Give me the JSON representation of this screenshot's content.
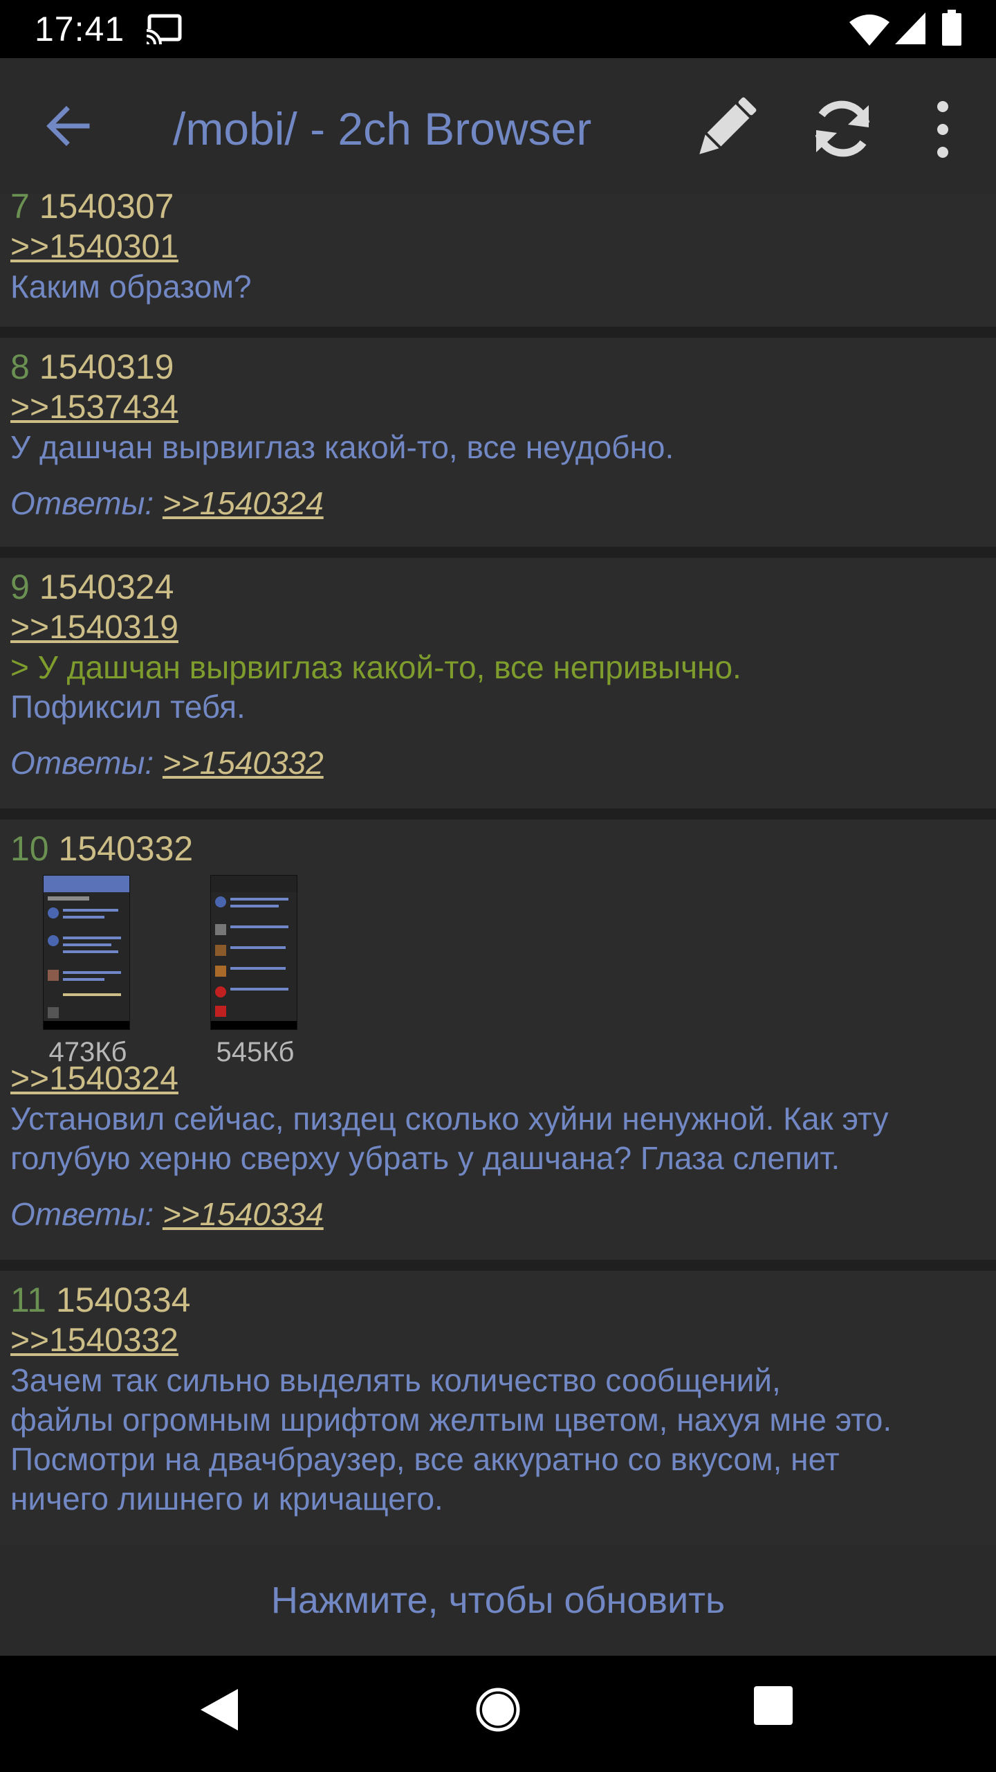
{
  "status_bar": {
    "time": "17:41"
  },
  "toolbar": {
    "title": "/mobi/ - 2ch Browser"
  },
  "posts": [
    {
      "index": "7",
      "number": "1540307",
      "reply_to": ">>1540301",
      "text": "Каким образом?"
    },
    {
      "index": "8",
      "number": "1540319",
      "reply_to": ">>1537434",
      "text": "У дашчан вырвиглаз какой-то, все неудобно.",
      "replies_label": "Ответы:",
      "replies": ">>1540324"
    },
    {
      "index": "9",
      "number": "1540324",
      "reply_to": ">>1540319",
      "quote": "> У дашчан вырвиглаз какой-то, все непривычно.",
      "text": "Пофиксил тебя.",
      "replies_label": "Ответы:",
      "replies": ">>1540332"
    },
    {
      "index": "10",
      "number": "1540332",
      "attachments": [
        {
          "size": "473Кб"
        },
        {
          "size": "545Кб"
        }
      ],
      "reply_to": ">>1540324",
      "text_line1": "Установил сейчас, пиздец сколько хуйни ненужной. Как эту",
      "text_line2": "голубую херню сверху убрать у дашчана? Глаза слепит.",
      "replies_label": "Ответы:",
      "replies": ">>1540334"
    },
    {
      "index": "11",
      "number": "1540334",
      "reply_to": ">>1540332",
      "text_line1": "Зачем так сильно выделять количество сообщений,",
      "text_line2": "файлы огромным шрифтом желтым цветом, нахуя мне это.",
      "text_line3": "Посмотри на двачбраузер, все аккуратно со вкусом, нет",
      "text_line4": "ничего лишнего и кричащего."
    }
  ],
  "refresh_bar": {
    "label": "Нажмите, чтобы обновить"
  },
  "colors": {
    "accent": "#7288c4",
    "link": "#cdbd86",
    "post_index": "#6a9151",
    "quote": "#7f9d2d",
    "post_bg": "#2c2c2c"
  },
  "icons": {
    "back": "arrow-back-icon",
    "edit": "pencil-icon",
    "refresh": "refresh-icon",
    "menu": "more-vert-icon"
  }
}
